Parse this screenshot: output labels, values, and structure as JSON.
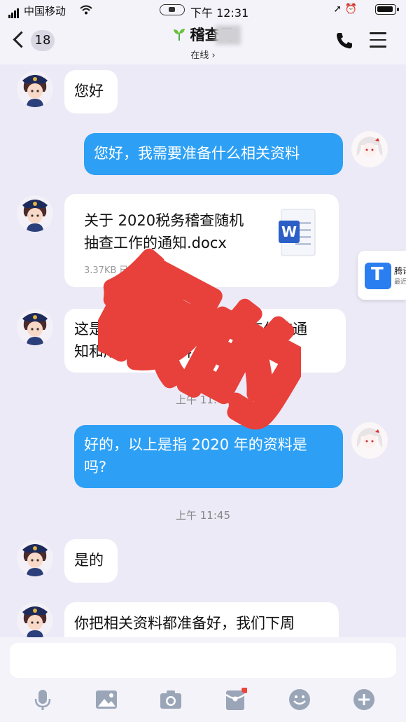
{
  "status_bar": {
    "carrier": "中国移动",
    "time": "下午 12:31"
  },
  "header": {
    "unread_count": "18",
    "title": "稽查局",
    "status": "在线 ›"
  },
  "messages": [
    {
      "side": "in",
      "text": "您好"
    },
    {
      "side": "out",
      "text": "您好，我需要准备什么相关资料"
    },
    {
      "side": "in",
      "type": "file",
      "file_name": "关于2020税务稽查随机抽查工作的通知.docx",
      "file_name_line1": "关于 2020税务稽查随机",
      "file_name_line2": "抽查工作的通知.docx",
      "file_size": "3.37KB 已下载"
    },
    {
      "side": "in",
      "text_line1": "这是关于 2020年税务稽查工作的通",
      "text_line2": "知和所需相关资料"
    },
    {
      "side": "out",
      "text_line1": "好的，以上是指 2020 年的资料是",
      "text_line2": "吗?"
    },
    {
      "side": "in",
      "text": "是的"
    },
    {
      "side": "in",
      "text": "你把相关资料都准备好，我们下周"
    }
  ],
  "timestamps": [
    "上午 11:40",
    "上午 11:45"
  ],
  "stamp": {
    "text": "假的",
    "color": "#e8403a"
  },
  "side_panel": {
    "line1": "腾讯",
    "line2": "最近"
  },
  "colors": {
    "outgoing_bubble": "#2da0f5",
    "incoming_bubble": "#ffffff",
    "background": "#eceaf6"
  },
  "toolbar_icons": [
    "microphone-icon",
    "image-icon",
    "camera-icon",
    "red-packet-icon",
    "emoji-icon",
    "plus-icon"
  ]
}
